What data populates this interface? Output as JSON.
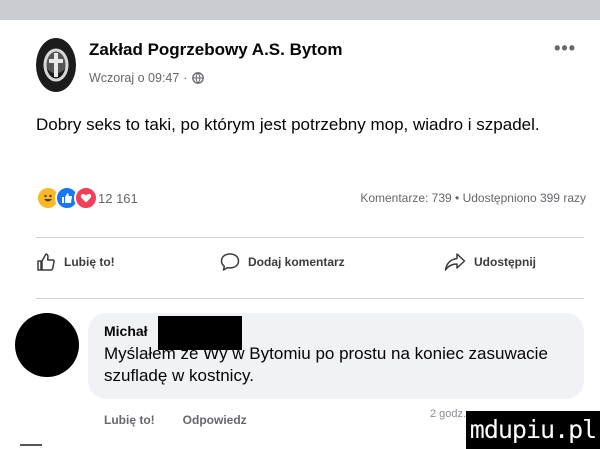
{
  "post": {
    "page_name": "Zakład Pogrzebowy A.S. Bytom",
    "time": "Wczoraj o 09:47",
    "meta_separator": "·",
    "more": "•••",
    "text": "Dobry seks to taki, po którym jest potrzebny mop, wiadro i szpadel.",
    "reactions": {
      "icons": [
        "haha-icon",
        "like-icon",
        "love-icon"
      ],
      "count": "12 161",
      "stats": "Komentarze: 739 • Udostępniono 399 razy"
    },
    "actions": {
      "like": "Lubię to!",
      "comment": "Dodaj komentarz",
      "share": "Udostępnij"
    }
  },
  "comment": {
    "author": "Michał",
    "text": "Myślałem że Wy w Bytomiu po prostu na koniec zasuwacie szufladę w kostnicy.",
    "like": "Lubię to!",
    "reply": "Odpowiedz",
    "time_fragment": "2 godz."
  },
  "watermark": "mdupiu.pl",
  "colors": {
    "top_bar": "#c9ccd1",
    "secondary_text": "#65676b",
    "bubble": "#f0f2f5",
    "like_blue": "#1877f2",
    "love_red": "#f33e58",
    "haha_yellow": "#f7b928"
  }
}
